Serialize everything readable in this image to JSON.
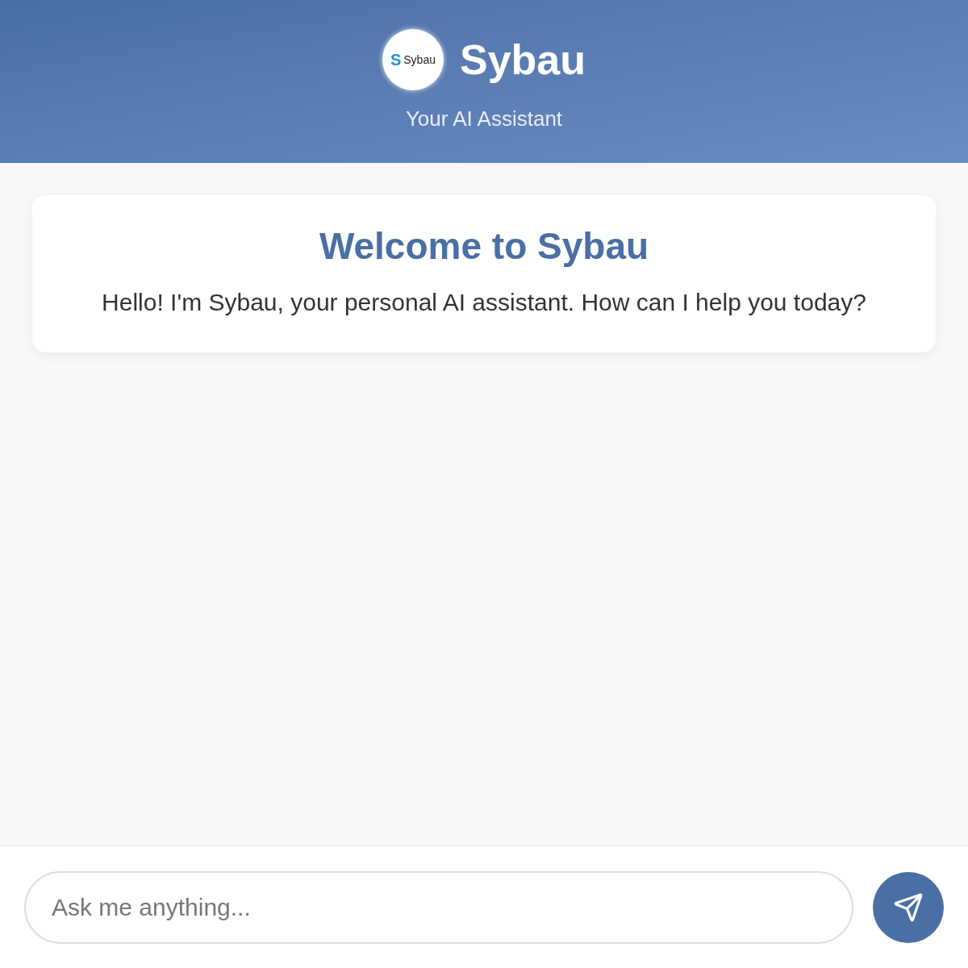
{
  "header": {
    "logo": {
      "mark": "S",
      "text": "Sybau"
    },
    "title": "Sybau",
    "subtitle": "Your AI Assistant"
  },
  "welcome": {
    "title": "Welcome to Sybau",
    "message": "Hello! I'm Sybau, your personal AI assistant. How can I help you today?"
  },
  "composer": {
    "placeholder": "Ask me anything..."
  }
}
